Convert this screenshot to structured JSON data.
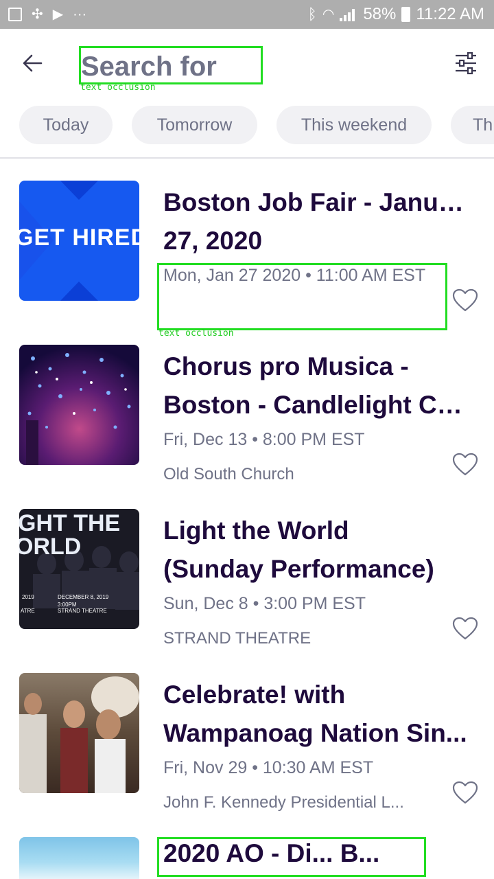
{
  "status_bar": {
    "battery": "58%",
    "time": "11:22 AM"
  },
  "header": {
    "search_placeholder": "Search for",
    "occlusion_label": "text occlusion"
  },
  "chips": [
    "Today",
    "Tomorrow",
    "This weekend",
    "Th"
  ],
  "events": [
    {
      "title_line1": "Boston Job Fair - January",
      "title_line2": "27, 2020",
      "date": "Mon, Jan 27 2020 • 11:00 AM EST",
      "venue": "",
      "thumb_text": "GET HIRED",
      "occlusion_label": "text occlusion"
    },
    {
      "title_line1": "Chorus pro Musica -",
      "title_line2": "Boston - Candlelight Ch...",
      "date": "Fri, Dec 13 • 8:00 PM EST",
      "venue": "Old South Church"
    },
    {
      "title_line1": "Light the World",
      "title_line2": "(Sunday Performance)",
      "date": "Sun, Dec 8 • 3:00 PM EST",
      "venue": "STRAND THEATRE",
      "thumb_big": "GHT THE",
      "thumb_big2": "ORLD",
      "thumb_small1": "DECEMBER 8, 2019",
      "thumb_small2": "3:00PM",
      "thumb_small3": "STRAND THEATRE",
      "thumb_left1": "2019",
      "thumb_left2": "ATRE"
    },
    {
      "title_line1": "Celebrate! with",
      "title_line2": "Wampanoag Nation Sin...",
      "date": "Fri, Nov 29 • 10:30 AM EST",
      "venue": "John F. Kennedy Presidential L..."
    },
    {
      "title_partial": "2020 AO - Di... B..."
    }
  ],
  "colors": {
    "primary_text": "#1e0a3c",
    "secondary_text": "#6f7287",
    "chip_bg": "#f1f1f4",
    "occlusion": "#22dd22"
  }
}
